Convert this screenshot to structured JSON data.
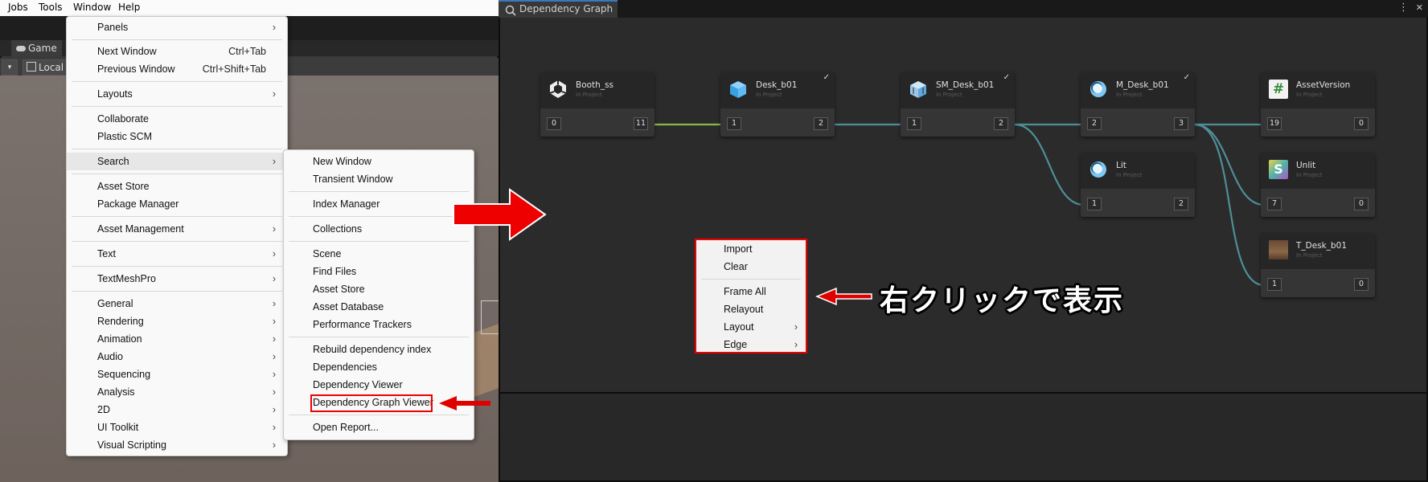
{
  "menubar": {
    "items": [
      "Jobs",
      "Tools",
      "Window",
      "Help"
    ]
  },
  "editor": {
    "game_tab": "Game",
    "local_label": "Local"
  },
  "window_menu": {
    "items": [
      {
        "label": "Panels",
        "submenu": true
      },
      {
        "label": "Next Window",
        "shortcut": "Ctrl+Tab"
      },
      {
        "label": "Previous Window",
        "shortcut": "Ctrl+Shift+Tab"
      },
      {
        "label": "Layouts",
        "submenu": true
      },
      {
        "label": "Collaborate"
      },
      {
        "label": "Plastic SCM"
      },
      {
        "label": "Search",
        "submenu": true,
        "highlighted": true
      },
      {
        "label": "Asset Store"
      },
      {
        "label": "Package Manager"
      },
      {
        "label": "Asset Management",
        "submenu": true
      },
      {
        "label": "Text",
        "submenu": true
      },
      {
        "label": "TextMeshPro",
        "submenu": true
      },
      {
        "label": "General",
        "submenu": true
      },
      {
        "label": "Rendering",
        "submenu": true
      },
      {
        "label": "Animation",
        "submenu": true
      },
      {
        "label": "Audio",
        "submenu": true
      },
      {
        "label": "Sequencing",
        "submenu": true
      },
      {
        "label": "Analysis",
        "submenu": true
      },
      {
        "label": "2D",
        "submenu": true
      },
      {
        "label": "UI Toolkit",
        "submenu": true
      },
      {
        "label": "Visual Scripting",
        "submenu": true
      }
    ]
  },
  "search_menu": {
    "items": [
      {
        "label": "New Window"
      },
      {
        "label": "Transient Window"
      },
      {
        "label": "Index Manager"
      },
      {
        "label": "Collections"
      },
      {
        "label": "Scene"
      },
      {
        "label": "Find Files"
      },
      {
        "label": "Asset Store"
      },
      {
        "label": "Asset Database"
      },
      {
        "label": "Performance Trackers"
      },
      {
        "label": "Rebuild dependency index"
      },
      {
        "label": "Dependencies"
      },
      {
        "label": "Dependency Viewer"
      },
      {
        "label": "Dependency Graph Viewer",
        "boxed": true
      },
      {
        "label": "Open Report..."
      }
    ]
  },
  "graph_window": {
    "title": "Dependency Graph"
  },
  "nodes": [
    {
      "name": "Booth_ss",
      "sub": "In Project",
      "in": "0",
      "out": "11",
      "icon": "unity-logo-icon"
    },
    {
      "name": "Desk_b01",
      "sub": "In Project",
      "in": "1",
      "out": "2",
      "icon": "prefab-cube-icon",
      "checked": true
    },
    {
      "name": "SM_Desk_b01",
      "sub": "In Project",
      "in": "1",
      "out": "2",
      "icon": "model-prefab-icon",
      "checked": true
    },
    {
      "name": "M_Desk_b01",
      "sub": "In Project",
      "in": "2",
      "out": "3",
      "icon": "material-sphere-icon",
      "checked": true
    },
    {
      "name": "AssetVersion",
      "sub": "In Project",
      "in": "19",
      "out": "0",
      "icon": "csharp-script-icon"
    },
    {
      "name": "Lit",
      "sub": "In Project",
      "in": "1",
      "out": "2",
      "icon": "material-sphere-icon"
    },
    {
      "name": "Unlit",
      "sub": "In Project",
      "in": "7",
      "out": "0",
      "icon": "shader-icon"
    },
    {
      "name": "T_Desk_b01",
      "sub": "In Project",
      "in": "1",
      "out": "0",
      "icon": "texture-thumbnail-icon"
    }
  ],
  "context_menu": {
    "items": [
      {
        "label": "Import"
      },
      {
        "label": "Clear"
      },
      {
        "label": "Frame All"
      },
      {
        "label": "Relayout"
      },
      {
        "label": "Layout",
        "submenu": true
      },
      {
        "label": "Edge",
        "submenu": true
      }
    ]
  },
  "annotation": {
    "text": "右クリックで表示"
  },
  "colors": {
    "highlight_red": "#ee0000",
    "edge_teal": "#4e8f97",
    "edge_green": "#8cb84a",
    "graph_bg": "#2b2b2b"
  },
  "glyphs": {
    "arrow": "›",
    "check": "✓",
    "play": "▶",
    "csharp": "#",
    "shader": "S",
    "dots": "⋮",
    "close": "✕"
  }
}
